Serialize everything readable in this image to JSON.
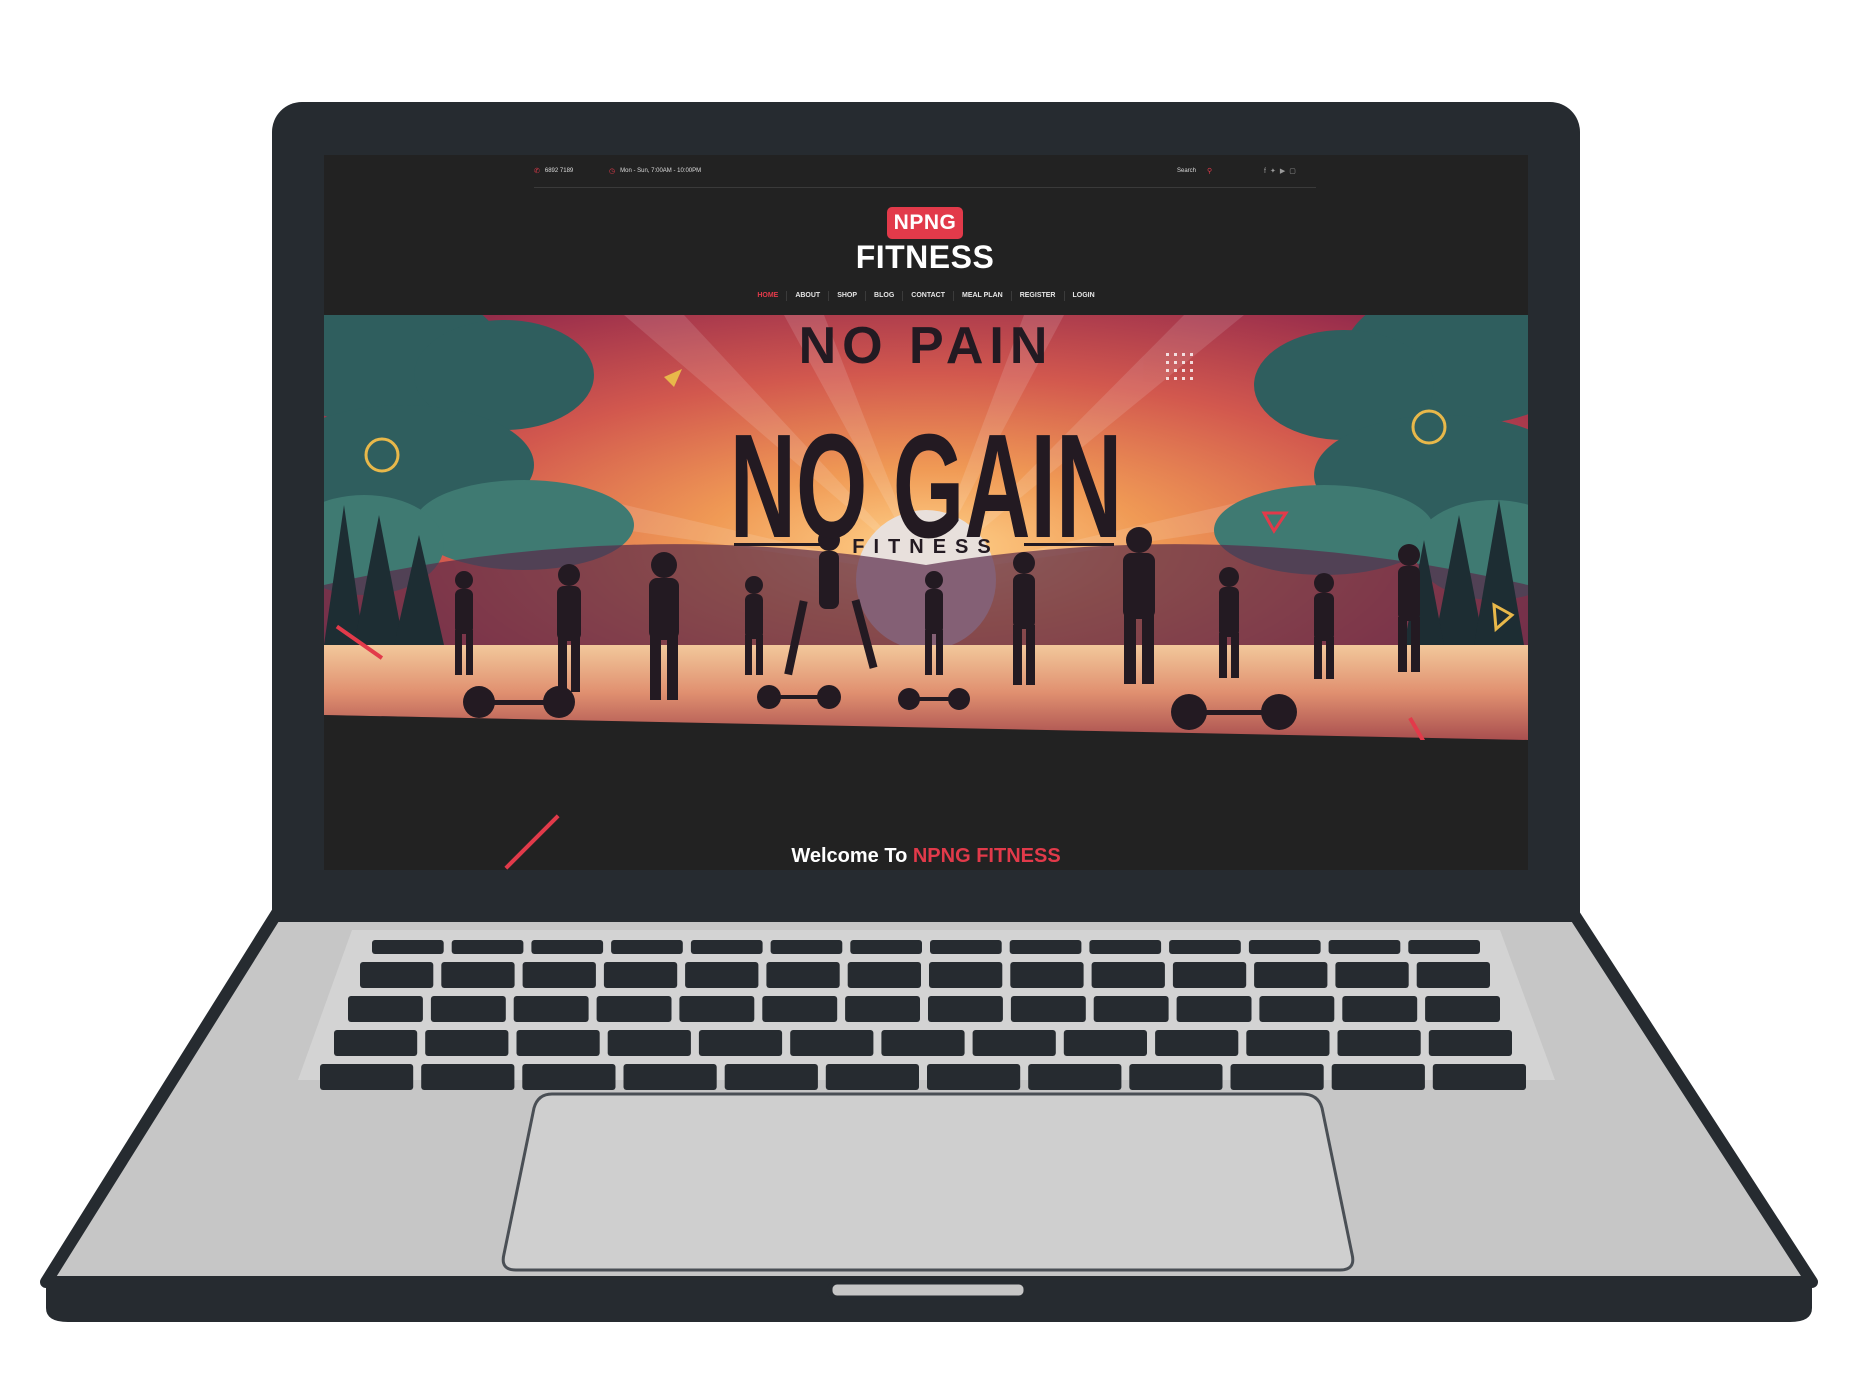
{
  "topbar": {
    "phone": "6892 7189",
    "hours": "Mon - Sun, 7:00AM - 10:00PM",
    "search_label": "Search"
  },
  "logo": {
    "badge": "NPNG",
    "word": "FITNESS"
  },
  "nav": {
    "items": [
      "HOME",
      "ABOUT",
      "SHOP",
      "BLOG",
      "CONTACT",
      "MEAL PLAN",
      "REGISTER",
      "LOGIN"
    ],
    "active": "HOME"
  },
  "hero": {
    "line1": "NO PAIN",
    "line2": "NO GAIN",
    "line3": "FITNESS"
  },
  "welcome": {
    "prefix": "Welcome To",
    "brand": "NPNG FITNESS"
  },
  "icons": [
    "phone-icon",
    "clock-icon",
    "search-icon",
    "facebook-icon",
    "twitter-icon",
    "youtube-icon",
    "instagram-icon"
  ],
  "colors": {
    "accent": "#e23a4a",
    "page_bg": "#222222",
    "laptop_frame": "#262b30",
    "laptop_base": "#c4c4c4"
  }
}
